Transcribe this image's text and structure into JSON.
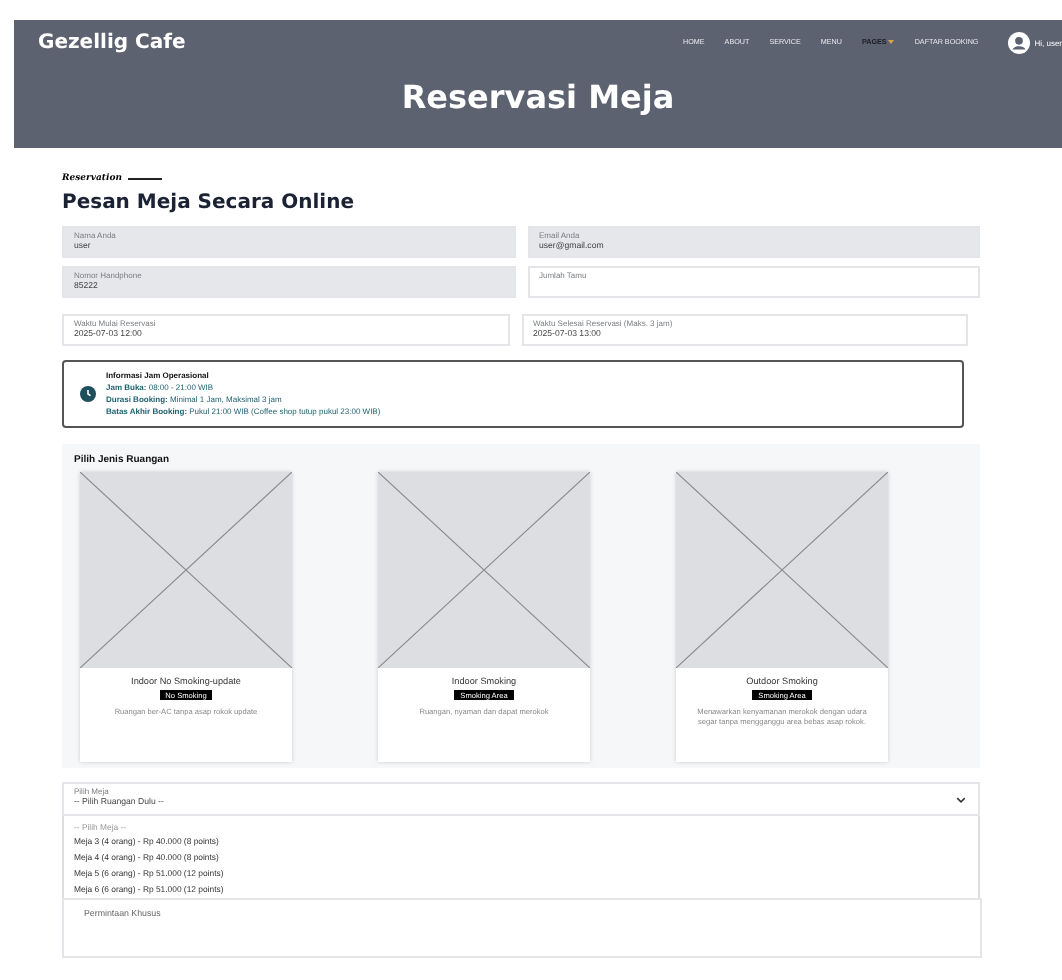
{
  "navbar": {
    "brand": "Gezellig Cafe",
    "links": [
      {
        "label": "HOME",
        "selected": false,
        "dropdown": false
      },
      {
        "label": "ABOUT",
        "selected": false,
        "dropdown": false
      },
      {
        "label": "SERVICE",
        "selected": false,
        "dropdown": false
      },
      {
        "label": "MENU",
        "selected": false,
        "dropdown": false
      },
      {
        "label": "PAGES",
        "selected": true,
        "dropdown": true
      },
      {
        "label": "DAFTAR BOOKING",
        "selected": false,
        "dropdown": false
      }
    ],
    "user": "Hi, user"
  },
  "hero": {
    "title": "Reservasi Meja"
  },
  "form": {
    "eyebrow": "Reservation",
    "title": "Pesan Meja Secara Online",
    "fields": [
      {
        "label": "Nama Anda",
        "value": "user",
        "disabled": true
      },
      {
        "label": "Email Anda",
        "value": "user@gmail.com",
        "disabled": true
      },
      {
        "label": "Nomor Handphone",
        "value": "85222",
        "disabled": true
      },
      {
        "label": "Jumlah Tamu",
        "disabled": false
      }
    ],
    "time_fields": [
      {
        "label": "Waktu Mulai Reservasi",
        "value": "2025-07-03 12:00"
      },
      {
        "label": "Waktu Selesai Reservasi (Maks. 3 jam)",
        "value": "2025-07-03 13:00"
      }
    ],
    "info": {
      "title": "Informasi Jam Operasional",
      "lines": [
        "**Jam Buka:** 08:00 - 21:00 WIB",
        "**Durasi Booking:** Minimal 1 Jam, Maksimal 3 jam",
        "**Batas Akhir Booking:** Pukul 21:00 WIB (Coffee shop tutup pukul 23:00 WIB)"
      ]
    },
    "rooms": {
      "title": "Pilih Jenis Ruangan",
      "items": [
        {
          "name": "Indoor No Smoking-update",
          "badge": "No Smoking",
          "description": "Ruangan ber-AC tanpa asap rokok update"
        },
        {
          "name": "Indoor Smoking",
          "badge": "Smoking Area",
          "description": "Ruangan, nyaman dan dapat merokok"
        },
        {
          "name": "Outdoor Smoking",
          "badge": "Smoking Area",
          "description": "Menawarkan kenyamanan merokok dengan udara segar tanpa mengganggu area bebas asap rokok."
        }
      ]
    },
    "table_select": {
      "label": "Pilih Meja",
      "value": "-- Pilih Ruangan Dulu --",
      "expanded": true,
      "options": [
        {
          "label": "-- Pilih Meja --",
          "kind": "placeholder"
        },
        {
          "label": "Meja 3 (4 orang) - Rp 40.000 (8 points)",
          "kind": "option"
        },
        {
          "label": "Meja 4 (4 orang) - Rp 40.000 (8 points)",
          "kind": "option"
        },
        {
          "label": "Meja 5 (6 orang) - Rp 51.000 (12 points)",
          "kind": "option"
        },
        {
          "label": "Meja 6 (6 orang) - Rp 51.000 (12 points)",
          "kind": "option"
        }
      ]
    },
    "special_request": {
      "placeholder": "Permintaan Khusus"
    }
  }
}
